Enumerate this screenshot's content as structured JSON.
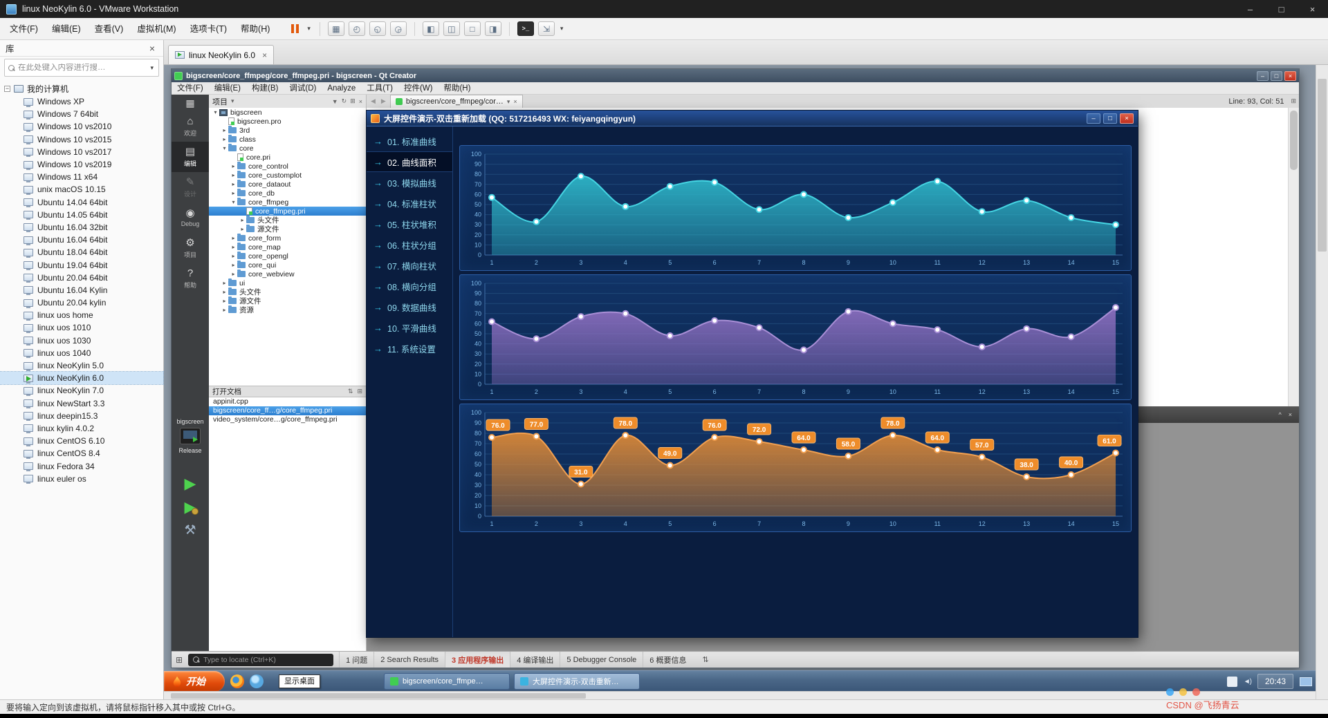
{
  "icons": {
    "minimize": "–",
    "maximize": "□",
    "close": "×",
    "dropdown": "▾",
    "expander_open": "▾",
    "expander_closed": "▸",
    "back": "◀",
    "forward": "▶",
    "menu_arrow": "→",
    "home": "⌂",
    "edit": "▤",
    "design": "✎",
    "debug": "◉",
    "projects": "⚙",
    "help": "?",
    "grid": "▦",
    "hammer": "⚒",
    "run": "▶",
    "split": "⊞",
    "updown": "⇅",
    "sync": "↻",
    "filter": "▼",
    "chevron_up": "^",
    "send_cad": "▦",
    "snapshot_take": "◴",
    "snapshot_revert": "◵",
    "snapshot_manager": "◶",
    "show_library": "◧",
    "show_thumbnails": "◫",
    "fullscreen": "□",
    "unity": "◨",
    "console": ">_",
    "stretch": "⇲",
    "volume": "◄)",
    "root_expander": "−"
  },
  "vmware": {
    "title": "linux NeoKylin 6.0 - VMware Workstation",
    "menu": [
      "文件(F)",
      "编辑(E)",
      "查看(V)",
      "虚拟机(M)",
      "选项卡(T)",
      "帮助(H)"
    ],
    "tab": "linux NeoKylin 6.0",
    "status": "要将输入定向到该虚拟机，请将鼠标指针移入其中或按 Ctrl+G。",
    "library": {
      "title": "库",
      "search_placeholder": "在此处键入内容进行搜…",
      "root": "我的计算机",
      "active_vm": "linux NeoKylin 6.0",
      "vms": [
        "Windows XP",
        "Windows 7 64bit",
        "Windows 10 vs2010",
        "Windows 10 vs2015",
        "Windows 10 vs2017",
        "Windows 10 vs2019",
        "Windows 11 x64",
        "unix macOS 10.15",
        "Ubuntu 14.04 64bit",
        "Ubuntu 14.05 64bit",
        "Ubuntu 16.04 32bit",
        "Ubuntu 16.04 64bit",
        "Ubuntu 18.04 64bit",
        "Ubuntu 19.04 64bit",
        "Ubuntu 20.04 64bit",
        "Ubuntu 16.04 Kylin",
        "Ubuntu 20.04 kylin",
        "linux uos home",
        "linux uos 1010",
        "linux uos 1030",
        "linux uos 1040",
        "linux NeoKylin 5.0",
        "linux NeoKylin 6.0",
        "linux NeoKylin 7.0",
        "linux NewStart 3.3",
        "linux deepin15.3",
        "linux kylin 4.0.2",
        "linux CentOS 6.10",
        "linux CentOS 8.4",
        "linux Fedora 34",
        "linux euler os"
      ]
    }
  },
  "qtcreator": {
    "title": "bigscreen/core_ffmpeg/core_ffmpeg.pri - bigscreen - Qt Creator",
    "menu": [
      "文件(F)",
      "编辑(E)",
      "构建(B)",
      "调试(D)",
      "Analyze",
      "工具(T)",
      "控件(W)",
      "帮助(H)"
    ],
    "line_col": "Line: 93, Col: 51",
    "doc_tab": "bigscreen/core_ffmpeg/cor…",
    "modes": [
      {
        "label": "欢迎",
        "icon": "home"
      },
      {
        "label": "编辑",
        "icon": "edit",
        "active": true
      },
      {
        "label": "设计",
        "icon": "design",
        "disabled": true
      },
      {
        "label": "Debug",
        "icon": "debug"
      },
      {
        "label": "项目",
        "icon": "projects"
      },
      {
        "label": "帮助",
        "icon": "help"
      }
    ],
    "project_panel": {
      "title": "项目",
      "tree": [
        {
          "label": "bigscreen",
          "depth": 0,
          "icon": "project",
          "exp": "open"
        },
        {
          "label": "bigscreen.pro",
          "depth": 1,
          "icon": "qtfile",
          "exp": "none"
        },
        {
          "label": "3rd",
          "depth": 1,
          "icon": "folder",
          "exp": "closed"
        },
        {
          "label": "class",
          "depth": 1,
          "icon": "folder",
          "exp": "closed"
        },
        {
          "label": "core",
          "depth": 1,
          "icon": "folder",
          "exp": "open"
        },
        {
          "label": "core.pri",
          "depth": 2,
          "icon": "qtfile",
          "exp": "none"
        },
        {
          "label": "core_control",
          "depth": 2,
          "icon": "folder",
          "exp": "closed"
        },
        {
          "label": "core_customplot",
          "depth": 2,
          "icon": "folder",
          "exp": "closed"
        },
        {
          "label": "core_dataout",
          "depth": 2,
          "icon": "folder",
          "exp": "closed"
        },
        {
          "label": "core_db",
          "depth": 2,
          "icon": "folder",
          "exp": "closed"
        },
        {
          "label": "core_ffmpeg",
          "depth": 2,
          "icon": "folder",
          "exp": "open"
        },
        {
          "label": "core_ffmpeg.pri",
          "depth": 3,
          "icon": "qtfile",
          "exp": "none",
          "selected": true
        },
        {
          "label": "头文件",
          "depth": 3,
          "icon": "folder",
          "exp": "closed"
        },
        {
          "label": "源文件",
          "depth": 3,
          "icon": "folder",
          "exp": "closed"
        },
        {
          "label": "core_form",
          "depth": 2,
          "icon": "folder",
          "exp": "closed"
        },
        {
          "label": "core_map",
          "depth": 2,
          "icon": "folder",
          "exp": "closed"
        },
        {
          "label": "core_opengl",
          "depth": 2,
          "icon": "folder",
          "exp": "closed"
        },
        {
          "label": "core_qui",
          "depth": 2,
          "icon": "folder",
          "exp": "closed"
        },
        {
          "label": "core_webview",
          "depth": 2,
          "icon": "folder",
          "exp": "closed"
        },
        {
          "label": "ui",
          "depth": 1,
          "icon": "folder",
          "exp": "closed"
        },
        {
          "label": "头文件",
          "depth": 1,
          "icon": "folder",
          "exp": "closed"
        },
        {
          "label": "源文件",
          "depth": 1,
          "icon": "folder",
          "exp": "closed"
        },
        {
          "label": "资源",
          "depth": 1,
          "icon": "folder",
          "exp": "closed"
        }
      ]
    },
    "open_docs": {
      "title": "打开文档",
      "selected": 1,
      "items": [
        "appinit.cpp",
        "bigscreen/core_ff…g/core_ffmpeg.pri",
        "video_system/core…g/core_ffmpeg.pri"
      ]
    },
    "kit": {
      "project": "bigscreen",
      "config": "Release"
    },
    "locator_placeholder": "Type to locate (Ctrl+K)",
    "output_panes": [
      "1 问题",
      "2 Search Results",
      "3 应用程序输出",
      "4 编译输出",
      "5 Debugger Console",
      "6 概要信息"
    ],
    "active_output": "3 应用程序输出"
  },
  "demo": {
    "title": "大屏控件演示-双击重新加载 (QQ: 517216493  WX: feiyangqingyun)",
    "selected": "02. 曲线面积",
    "menu": [
      "01. 标准曲线",
      "02. 曲线面积",
      "03. 模拟曲线",
      "04. 标准柱状",
      "05. 柱状堆积",
      "06. 柱状分组",
      "07. 横向柱状",
      "08. 横向分组",
      "09. 数据曲线",
      "10. 平滑曲线",
      "11. 系统设置"
    ]
  },
  "chart_data": [
    {
      "type": "area",
      "x": [
        1,
        2,
        3,
        4,
        5,
        6,
        7,
        8,
        9,
        10,
        11,
        12,
        13,
        14,
        15
      ],
      "values": [
        57,
        33,
        78,
        48,
        68,
        72,
        45,
        60,
        37,
        52,
        73,
        43,
        54,
        37,
        30
      ],
      "ylim": [
        0,
        100
      ],
      "ytick_step": 10,
      "grid": true,
      "color": "#2eb8c9",
      "line_color": "#45d4e2",
      "axis_color": "#7cb8e8",
      "grid_color": "#1e4878",
      "axis_line_color": "#3f6ea8",
      "point_labels": false
    },
    {
      "type": "area",
      "x": [
        1,
        2,
        3,
        4,
        5,
        6,
        7,
        8,
        9,
        10,
        11,
        12,
        13,
        14,
        15
      ],
      "values": [
        62,
        45,
        67,
        70,
        48,
        63,
        56,
        34,
        72,
        60,
        54,
        37,
        55,
        47,
        76
      ],
      "ylim": [
        0,
        100
      ],
      "ytick_step": 10,
      "grid": true,
      "color": "#8e6fc0",
      "line_color": "#a98fd6",
      "axis_color": "#7cb8e8",
      "grid_color": "#1e4878",
      "axis_line_color": "#3f6ea8",
      "point_labels": false
    },
    {
      "type": "area",
      "x": [
        1,
        2,
        3,
        4,
        5,
        6,
        7,
        8,
        9,
        10,
        11,
        12,
        13,
        14,
        15
      ],
      "values": [
        76,
        77,
        31,
        78,
        49,
        76,
        72,
        64,
        58,
        78,
        64,
        57,
        38,
        40,
        61
      ],
      "labels": [
        "76.0",
        "77.0",
        "31.0",
        "78.0",
        "49.0",
        "76.0",
        "72.0",
        "64.0",
        "58.0",
        "78.0",
        "64.0",
        "57.0",
        "38.0",
        "40.0",
        "61.0"
      ],
      "ylim": [
        0,
        100
      ],
      "ytick_step": 10,
      "grid": true,
      "color": "#e08a35",
      "line_color": "#f2a050",
      "label_bg": "#ee8c2a",
      "label_border": "#f7b46a",
      "axis_color": "#7cb8e8",
      "grid_color": "#1e4878",
      "axis_line_color": "#3f6ea8",
      "point_labels": true
    }
  ],
  "taskbar": {
    "start": "开始",
    "show_desktop": "显示桌面",
    "tasks": [
      "bigscreen/core_ffmpe…",
      "大屏控件演示-双击重新…"
    ],
    "active_task": 1,
    "time": "20:43"
  },
  "watermark": {
    "text": "CSDN @飞扬青云"
  }
}
